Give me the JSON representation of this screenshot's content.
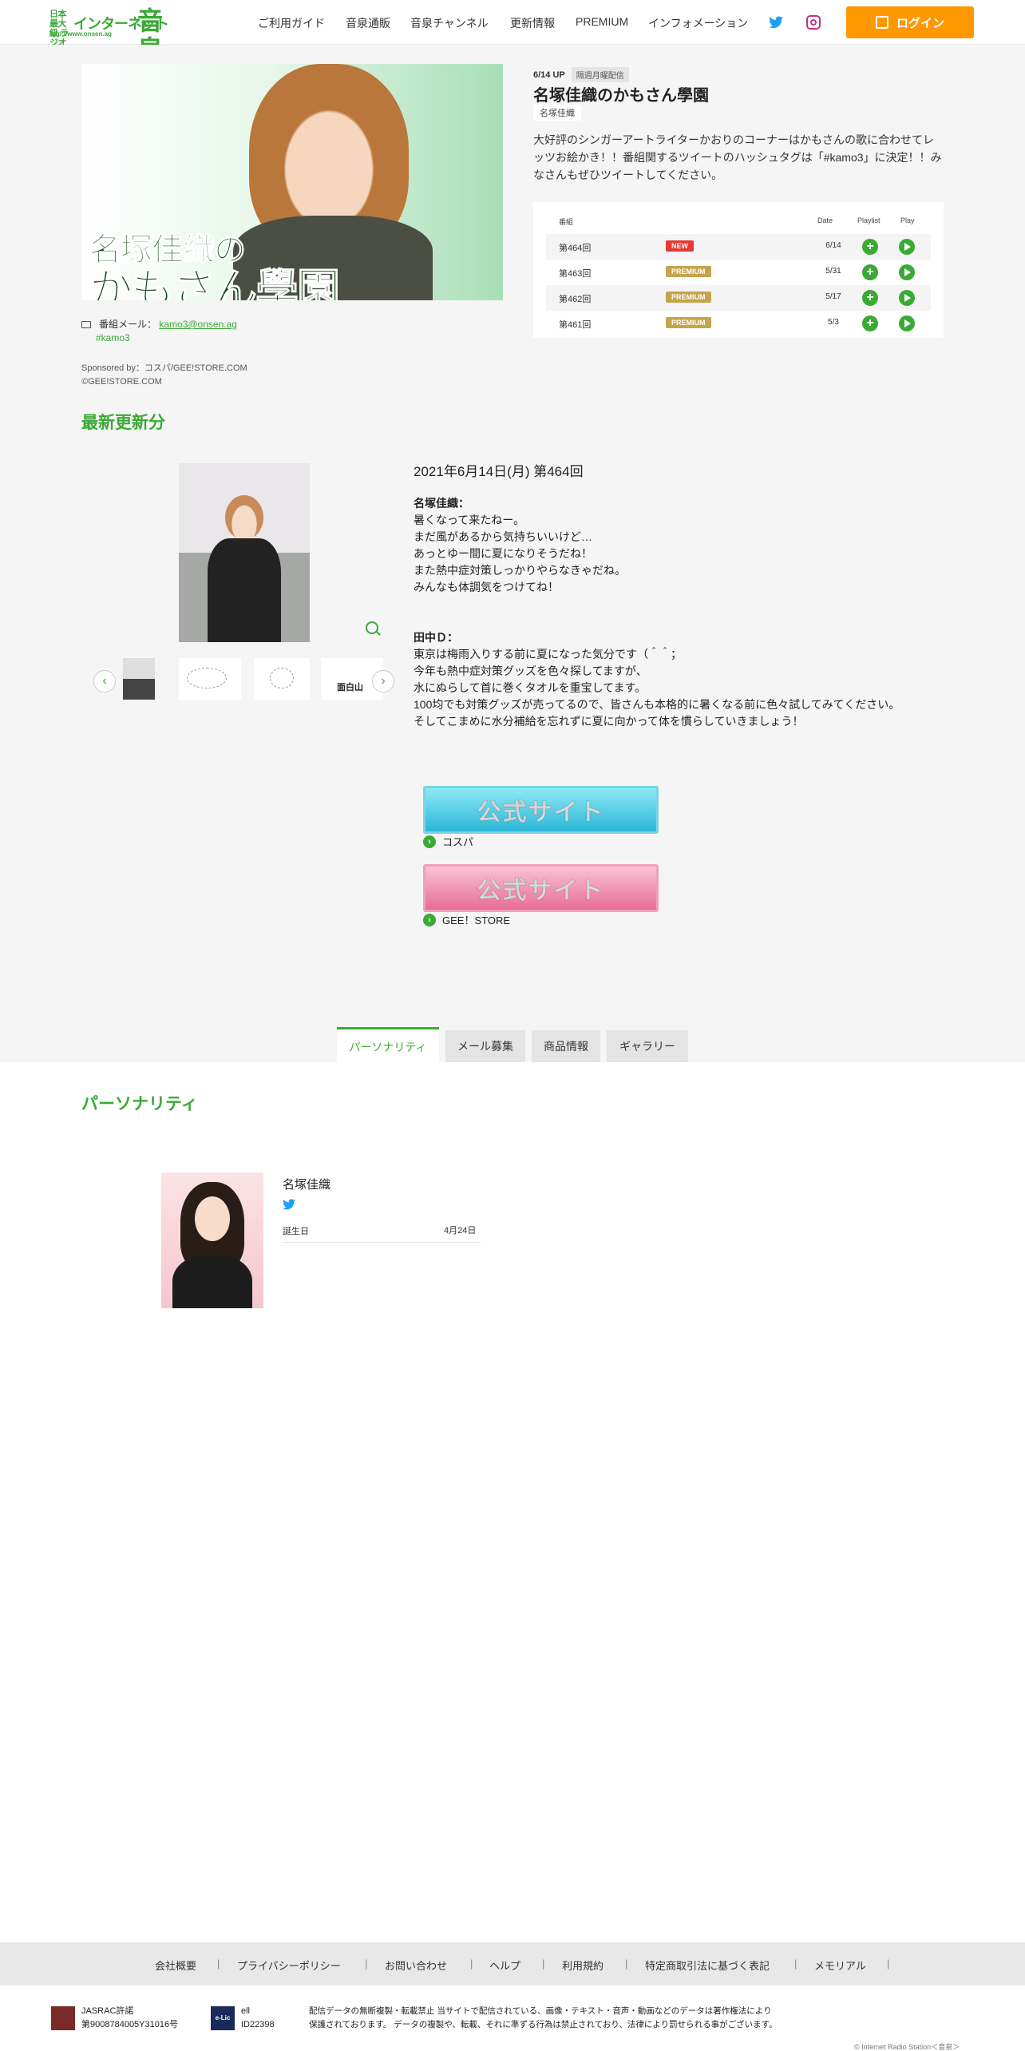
{
  "header": {
    "logo_small": "日本最大級 ラジオステーション",
    "logo_mid": "インターネット",
    "logo_big": "音泉",
    "logo_url": "http://www.onsen.ag",
    "nav": [
      "ご利用ガイド",
      "音泉通販",
      "音泉チャンネル",
      "更新情報",
      "PREMIUM",
      "インフォメーション"
    ],
    "login_label": "ログイン",
    "colors": {
      "accent": "#3aaa35",
      "login": "#ff9800",
      "twitter": "#1da1f2",
      "instagram": "#c13584"
    }
  },
  "program": {
    "hero_title_line1": "名塚佳織の",
    "hero_title_line2": "かもさん學園",
    "update_badge": "6/14 UP",
    "schedule_badge": "隔週月曜配信",
    "title": "名塚佳織のかもさん學園",
    "cast": "名塚佳織",
    "description": "大好評のシンガーアートライターかおりのコーナーはかもさんの歌に合わせてレッツお絵かき！！番組関するツイートのハッシュタグは「#kamo3」に決定！！みなさんもぜひツイートしてください。",
    "mail_label": "番組メール：",
    "mail_address": "kamo3@onsen.ag",
    "hashtag": "#kamo3",
    "sponsor_line1": "Sponsored by：コスパ/GEE!STORE.COM",
    "sponsor_line2": "©GEE!STORE.COM"
  },
  "episodes": {
    "headers": {
      "episode": "番組",
      "date": "Date",
      "playlist": "Playlist",
      "play": "Play"
    },
    "rows": [
      {
        "number": "第464回",
        "tag": "NEW",
        "date": "6/14"
      },
      {
        "number": "第463回",
        "tag": "PREMIUM",
        "date": "5/31"
      },
      {
        "number": "第462回",
        "tag": "PREMIUM",
        "date": "5/17"
      },
      {
        "number": "第461回",
        "tag": "PREMIUM",
        "date": "5/3"
      }
    ]
  },
  "latest": {
    "section_title": "最新更新分",
    "thumb4_text": "面白山",
    "post_date": "2021年6月14日(月) 第464回",
    "paragraphs": [
      {
        "author": "名塚佳織：",
        "lines": [
          "暑くなって来たねー。",
          "まだ風があるから気持ちいいけど…",
          "あっとゆー間に夏になりそうだね！",
          "また熱中症対策しっかりやらなきゃだね。",
          "みんなも体調気をつけてね！"
        ]
      },
      {
        "author": "田中Ｄ：",
        "lines": [
          "東京は梅雨入りする前に夏になった気分です（＾＾；",
          "今年も熱中症対策グッズを色々探してますが、",
          "水にぬらして首に巻くタオルを重宝してます。",
          "100均でも対策グッズが売ってるので、皆さんも本格的に暑くなる前に色々試してみてください。",
          "そしてこまめに水分補給を忘れずに夏に向かって体を慣らしていきましょう！"
        ]
      }
    ],
    "banners": [
      {
        "text": "公式サイト",
        "caption": "コスパ"
      },
      {
        "text": "公式サイト",
        "caption": "GEE！STORE"
      }
    ]
  },
  "tabs": [
    "パーソナリティ",
    "メール募集",
    "商品情報",
    "ギャラリー"
  ],
  "personality": {
    "section_title": "パーソナリティ",
    "name": "名塚佳織",
    "birthday_label": "誕生日",
    "birthday": "4月24日"
  },
  "footer": {
    "links": [
      "会社概要",
      "プライバシーポリシー",
      "お問い合わせ",
      "ヘルプ",
      "利用規約",
      "特定商取引法に基づく表記",
      "メモリアル"
    ],
    "jasrac_line1": "JASRAC許諾",
    "jasrac_line2": "第9008784005Y31016号",
    "elicense_logo": "e-Lic",
    "elicense_line1": "ell",
    "elicense_line2": "ID22398",
    "notice_line1": "配信データの無断複製・転載禁止 当サイトで配信されている、画像・テキスト・音声・動画などのデータは著作権法により",
    "notice_line2": "保護されております。 データの複製や、転載、それに準ずる行為は禁止されており、法律により罰せられる事がございます。",
    "copyright": "© Internet Radio Station＜音泉＞"
  }
}
